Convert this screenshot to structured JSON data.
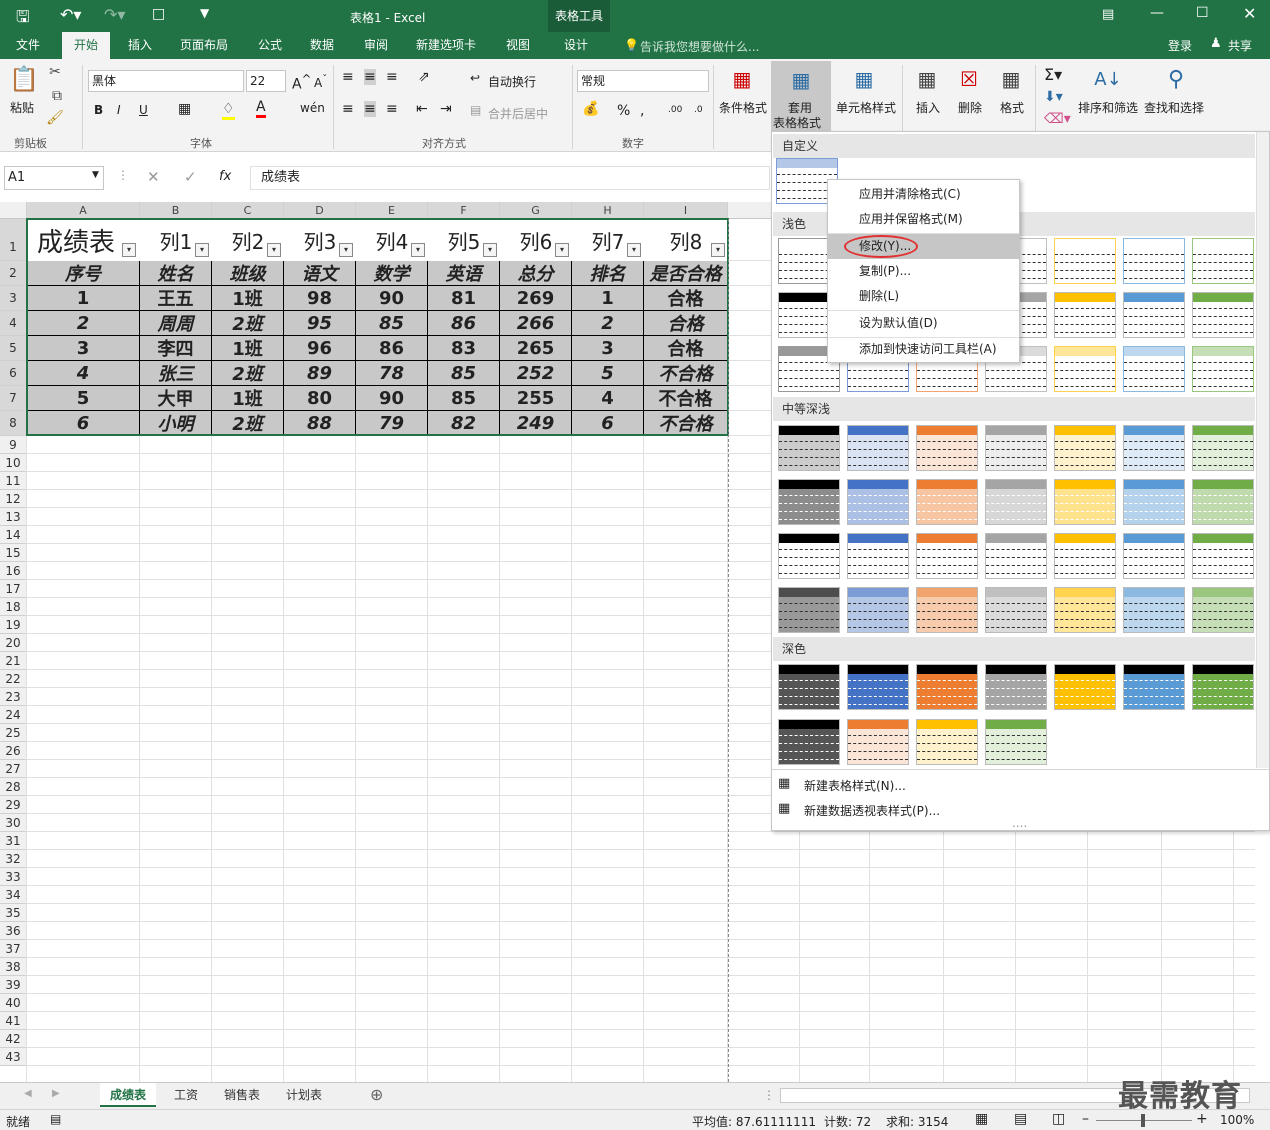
{
  "window": {
    "title": "表格1 - Excel",
    "context_tool": "表格工具"
  },
  "tabs": [
    "文件",
    "开始",
    "插入",
    "页面布局",
    "公式",
    "数据",
    "审阅",
    "新建选项卡",
    "视图",
    "设计"
  ],
  "tell_me": "告诉我您想要做什么...",
  "account": {
    "login": "登录",
    "share": "共享"
  },
  "ribbon": {
    "clipboard": {
      "paste": "粘贴",
      "label": "剪贴板"
    },
    "font": {
      "name": "黑体",
      "size": "22",
      "label": "字体",
      "bold": "B",
      "italic": "I",
      "underline": "U"
    },
    "alignment": {
      "wrap": "自动换行",
      "merge": "合并后居中",
      "label": "对齐方式"
    },
    "number": {
      "format": "常规",
      "label": "数字"
    },
    "styles": {
      "conditional": "条件格式",
      "table_format_1": "套用",
      "table_format_2": "表格格式",
      "cell_styles": "单元格样式"
    },
    "cells": {
      "insert": "插入",
      "delete": "删除",
      "format": "格式"
    },
    "editing": {
      "sort_filter": "排序和筛选",
      "find_select": "查找和选择"
    }
  },
  "formula_bar": {
    "name_box": "A1",
    "content": "成绩表",
    "fx": "fx"
  },
  "columns": [
    "A",
    "B",
    "C",
    "D",
    "E",
    "F",
    "G",
    "H",
    "I"
  ],
  "rows": [
    "1",
    "2",
    "3",
    "4",
    "5",
    "6",
    "7",
    "8",
    "9",
    "10",
    "11",
    "12",
    "13",
    "14",
    "15",
    "16",
    "17",
    "18",
    "19",
    "20",
    "21",
    "22",
    "23",
    "24",
    "25",
    "26",
    "27",
    "28",
    "29",
    "30",
    "31",
    "32",
    "33",
    "34",
    "35",
    "36",
    "37",
    "38",
    "39",
    "40",
    "41",
    "42",
    "43"
  ],
  "table": {
    "title": "成绩表",
    "header_row": [
      "列1",
      "列2",
      "列3",
      "列4",
      "列5",
      "列6",
      "列7",
      "列8"
    ],
    "field_row": [
      "序号",
      "姓名",
      "班级",
      "语文",
      "数学",
      "英语",
      "总分",
      "排名",
      "是否合格"
    ],
    "data": [
      [
        "1",
        "王五",
        "1班",
        "98",
        "90",
        "81",
        "269",
        "1",
        "合格"
      ],
      [
        "2",
        "周周",
        "2班",
        "95",
        "85",
        "86",
        "266",
        "2",
        "合格"
      ],
      [
        "3",
        "李四",
        "1班",
        "96",
        "86",
        "83",
        "265",
        "3",
        "合格"
      ],
      [
        "4",
        "张三",
        "2班",
        "89",
        "78",
        "85",
        "252",
        "5",
        "不合格"
      ],
      [
        "5",
        "大甲",
        "1班",
        "80",
        "90",
        "85",
        "255",
        "4",
        "不合格"
      ],
      [
        "6",
        "小明",
        "2班",
        "88",
        "79",
        "82",
        "249",
        "6",
        "不合格"
      ]
    ]
  },
  "style_gallery": {
    "sections": {
      "custom": "自定义",
      "light": "浅色",
      "medium": "中等深浅",
      "dark": "深色"
    },
    "footer": {
      "new_table_style": "新建表格样式(N)...",
      "new_pivot_style": "新建数据透视表样式(P)..."
    },
    "colors": [
      "#000000",
      "#4472c4",
      "#ed7d31",
      "#a5a5a5",
      "#ffc000",
      "#5b9bd5",
      "#70ad47"
    ]
  },
  "context_menu": {
    "items": [
      "应用并清除格式(C)",
      "应用并保留格式(M)",
      "修改(Y)...",
      "复制(P)...",
      "删除(L)",
      "设为默认值(D)",
      "添加到快速访问工具栏(A)"
    ],
    "highlighted": "修改(Y)..."
  },
  "sheet_tabs": [
    "成绩表",
    "工资",
    "销售表",
    "计划表"
  ],
  "status": {
    "ready": "就绪",
    "average": "平均值: 87.61111111",
    "count": "计数: 72",
    "sum": "求和: 3154",
    "zoom": "100%"
  },
  "watermark": "最需教育"
}
